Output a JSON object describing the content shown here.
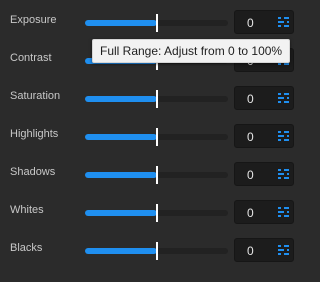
{
  "sliders": [
    {
      "label": "Exposure",
      "value": "0",
      "level": 0.5
    },
    {
      "label": "Contrast",
      "value": "0",
      "level": 0.5
    },
    {
      "label": "Saturation",
      "value": "0",
      "level": 0.5
    },
    {
      "label": "Highlights",
      "value": "0",
      "level": 0.5
    },
    {
      "label": "Shadows",
      "value": "0",
      "level": 0.5
    },
    {
      "label": "Whites",
      "value": "0",
      "level": 0.5
    },
    {
      "label": "Blacks",
      "value": "0",
      "level": 0.5
    }
  ],
  "tooltip": {
    "text": "Full Range: Adjust from 0 to 100%"
  },
  "colors": {
    "accent": "#1f8ff0",
    "track": "#222222",
    "background": "#2b2b2b"
  },
  "icons": {
    "stepper": "slider-adjust-icon"
  }
}
